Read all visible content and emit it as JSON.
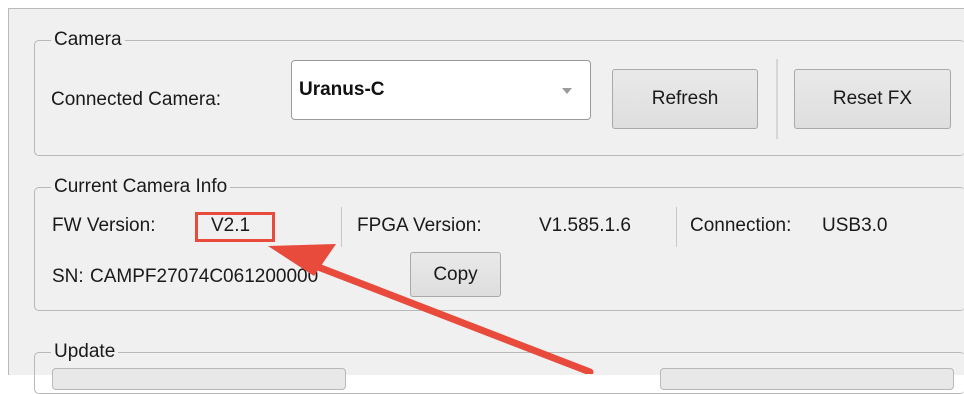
{
  "camera_group": {
    "title": "Camera",
    "connected_label": "Connected Camera:",
    "connected_value": "Uranus-C",
    "refresh_label": "Refresh",
    "reset_label": "Reset FX"
  },
  "info_group": {
    "title": "Current Camera Info",
    "fw_label": "FW Version:",
    "fw_value": "V2.1",
    "fpga_label": "FPGA Version:",
    "fpga_value": "V1.585.1.6",
    "connection_label": "Connection:",
    "connection_value": "USB3.0",
    "sn_label": "SN:",
    "sn_value": "CAMPF27074C061200000",
    "copy_label": "Copy"
  },
  "update_group": {
    "title": "Update"
  },
  "annotation": {
    "color": "#e84b3c"
  }
}
